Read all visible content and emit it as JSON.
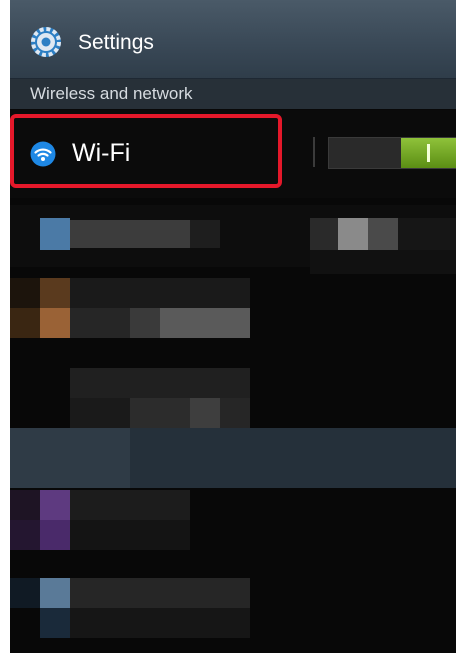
{
  "header": {
    "title": "Settings",
    "icon": "gear-icon"
  },
  "section": {
    "label": "Wireless and network"
  },
  "wifi": {
    "label": "Wi-Fi",
    "icon": "wifi-icon",
    "toggle_state": "on",
    "highlight_color": "#e4182a",
    "toggle_color": "#6ea31f"
  }
}
